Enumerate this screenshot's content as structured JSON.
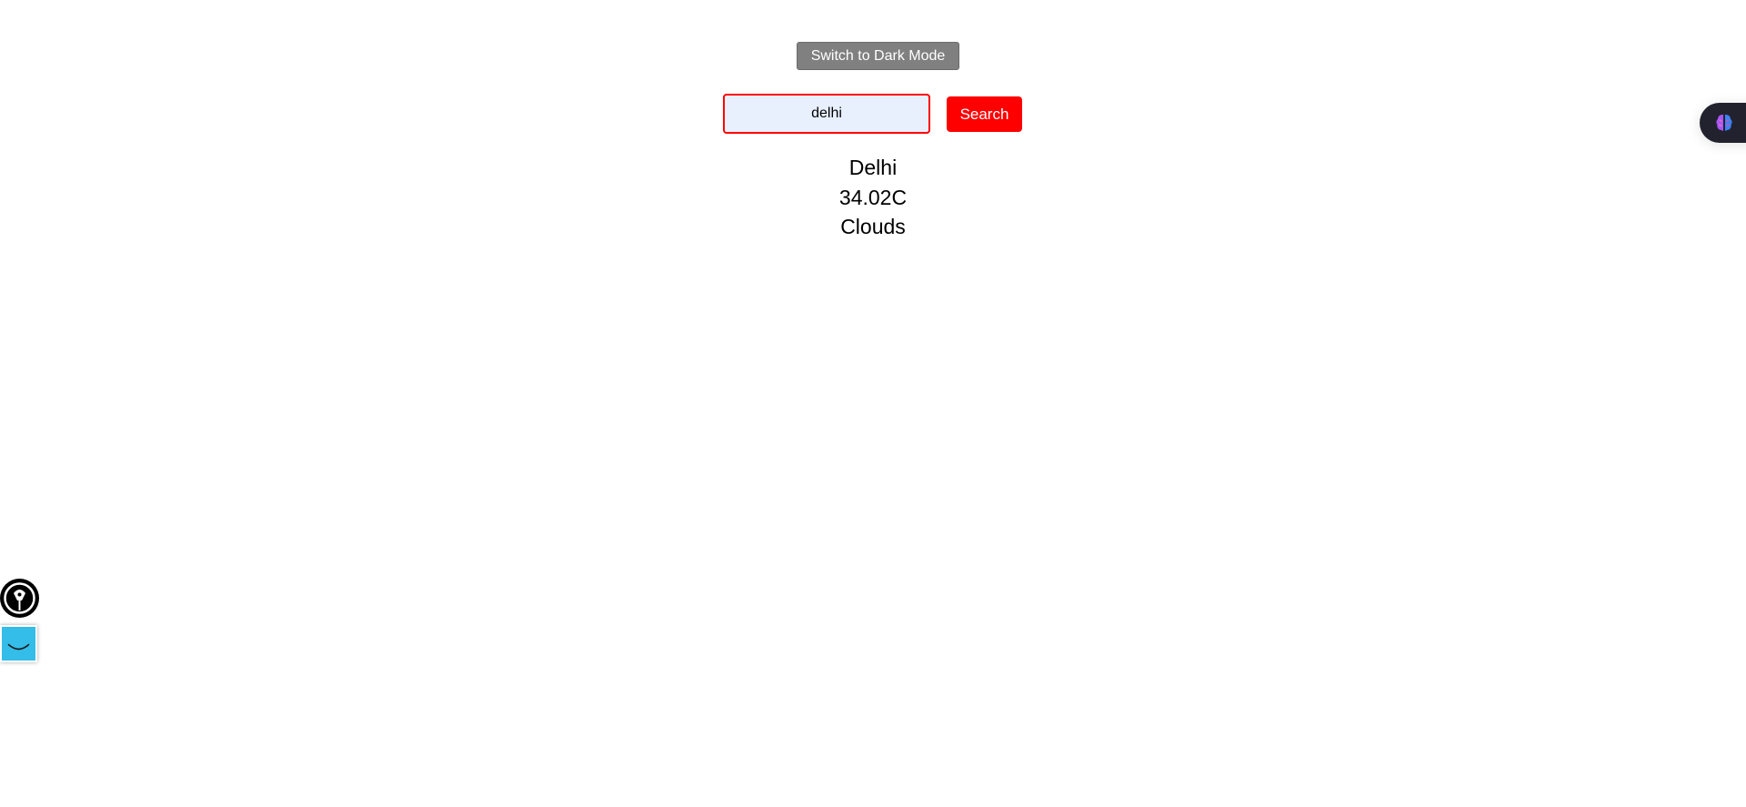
{
  "theme_toggle": {
    "label": "Switch to Dark Mode",
    "color": "#808080"
  },
  "search": {
    "value": "delhi",
    "button_label": "Search",
    "accent_color": "#ff0000",
    "input_background": "#e8f0fe"
  },
  "weather": {
    "city": "Delhi",
    "temperature": "34.02C",
    "condition": "Clouds"
  },
  "widgets": {
    "right": {
      "icon": "brain-icon",
      "background": "#22222e"
    },
    "left_top": {
      "icon": "pen-nib-icon",
      "background": "#000000"
    },
    "left_bottom": {
      "icon": "smile-face-icon",
      "background": "#33bde8"
    }
  }
}
